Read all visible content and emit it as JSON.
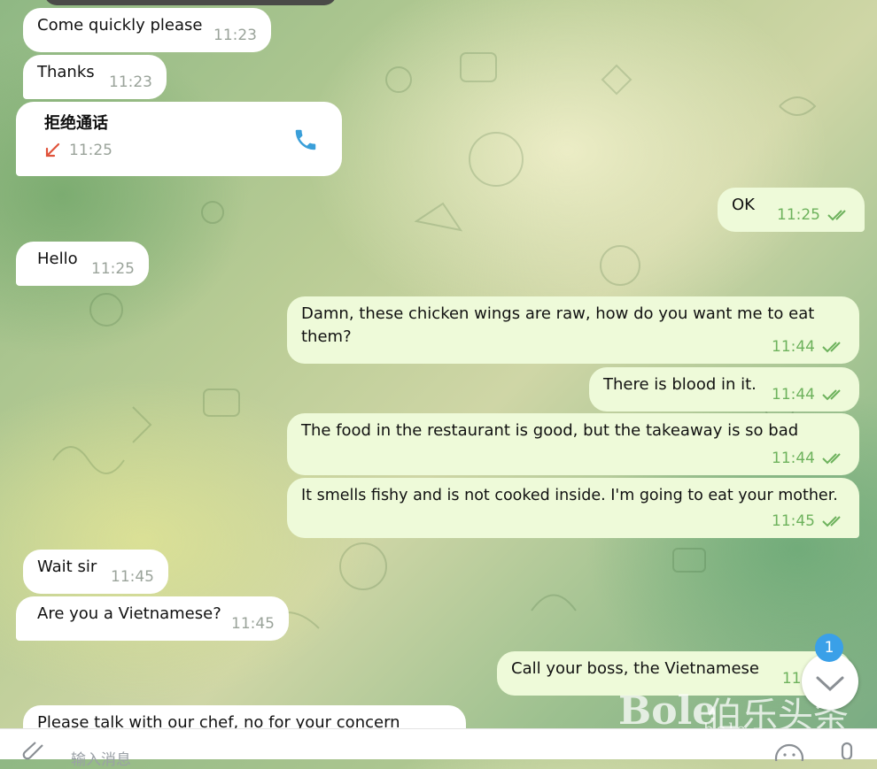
{
  "messages": {
    "m1": {
      "text": "Come quickly please",
      "time": "11:23"
    },
    "m2": {
      "text": "Thanks",
      "time": "11:23"
    },
    "call": {
      "title": "拒绝通话",
      "time": "11:25"
    },
    "m3": {
      "text": "OK",
      "time": "11:25"
    },
    "m4": {
      "text": "Hello",
      "time": "11:25"
    },
    "m5": {
      "text": "Damn, these chicken wings are raw, how do you want me to eat them?",
      "time": "11:44"
    },
    "m6": {
      "text": "There is blood in it.",
      "time": "11:44"
    },
    "m7": {
      "text": "The food in the restaurant is good, but the takeaway is so bad",
      "time": "11:44"
    },
    "m8": {
      "text": "It smells fishy and is not cooked inside. I'm going to eat your mother.",
      "time": "11:45"
    },
    "m9": {
      "text": "Wait sir",
      "time": "11:45"
    },
    "m10": {
      "text": "Are you a Vietnamese?",
      "time": "11:45"
    },
    "m11": {
      "text": "Call your boss, the Vietnamese",
      "time": "11:4"
    },
    "m12": {
      "text": "Please talk with our chef, no for your concern",
      "time": ""
    }
  },
  "composer": {
    "placeholder": "输入消息"
  },
  "scroll_badge": {
    "count": "1"
  },
  "watermark": {
    "brand": "Bole",
    "cn": "伯乐头条",
    "site": "bole"
  },
  "colors": {
    "outgoing": "#eefad9",
    "incoming": "#ffffff",
    "check": "#6db25c",
    "badge": "#3aa0e8",
    "missed_arrow": "#e0533b",
    "phone": "#3a9fd9"
  },
  "icons": [
    "double-check-icon",
    "missed-call-arrow-icon",
    "phone-icon",
    "attach-icon",
    "chevron-down-icon",
    "emoji-icon",
    "mic-icon"
  ]
}
